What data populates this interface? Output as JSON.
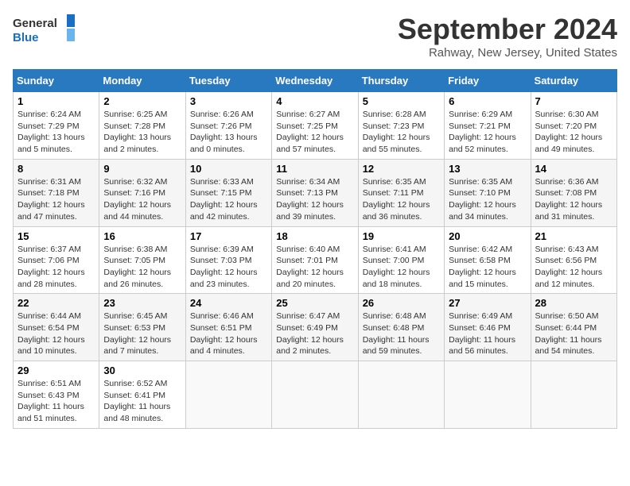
{
  "logo": {
    "line1": "General",
    "line2": "Blue"
  },
  "title": "September 2024",
  "location": "Rahway, New Jersey, United States",
  "days_header": [
    "Sunday",
    "Monday",
    "Tuesday",
    "Wednesday",
    "Thursday",
    "Friday",
    "Saturday"
  ],
  "weeks": [
    [
      {
        "day": "1",
        "info": "Sunrise: 6:24 AM\nSunset: 7:29 PM\nDaylight: 13 hours\nand 5 minutes."
      },
      {
        "day": "2",
        "info": "Sunrise: 6:25 AM\nSunset: 7:28 PM\nDaylight: 13 hours\nand 2 minutes."
      },
      {
        "day": "3",
        "info": "Sunrise: 6:26 AM\nSunset: 7:26 PM\nDaylight: 13 hours\nand 0 minutes."
      },
      {
        "day": "4",
        "info": "Sunrise: 6:27 AM\nSunset: 7:25 PM\nDaylight: 12 hours\nand 57 minutes."
      },
      {
        "day": "5",
        "info": "Sunrise: 6:28 AM\nSunset: 7:23 PM\nDaylight: 12 hours\nand 55 minutes."
      },
      {
        "day": "6",
        "info": "Sunrise: 6:29 AM\nSunset: 7:21 PM\nDaylight: 12 hours\nand 52 minutes."
      },
      {
        "day": "7",
        "info": "Sunrise: 6:30 AM\nSunset: 7:20 PM\nDaylight: 12 hours\nand 49 minutes."
      }
    ],
    [
      {
        "day": "8",
        "info": "Sunrise: 6:31 AM\nSunset: 7:18 PM\nDaylight: 12 hours\nand 47 minutes."
      },
      {
        "day": "9",
        "info": "Sunrise: 6:32 AM\nSunset: 7:16 PM\nDaylight: 12 hours\nand 44 minutes."
      },
      {
        "day": "10",
        "info": "Sunrise: 6:33 AM\nSunset: 7:15 PM\nDaylight: 12 hours\nand 42 minutes."
      },
      {
        "day": "11",
        "info": "Sunrise: 6:34 AM\nSunset: 7:13 PM\nDaylight: 12 hours\nand 39 minutes."
      },
      {
        "day": "12",
        "info": "Sunrise: 6:35 AM\nSunset: 7:11 PM\nDaylight: 12 hours\nand 36 minutes."
      },
      {
        "day": "13",
        "info": "Sunrise: 6:35 AM\nSunset: 7:10 PM\nDaylight: 12 hours\nand 34 minutes."
      },
      {
        "day": "14",
        "info": "Sunrise: 6:36 AM\nSunset: 7:08 PM\nDaylight: 12 hours\nand 31 minutes."
      }
    ],
    [
      {
        "day": "15",
        "info": "Sunrise: 6:37 AM\nSunset: 7:06 PM\nDaylight: 12 hours\nand 28 minutes."
      },
      {
        "day": "16",
        "info": "Sunrise: 6:38 AM\nSunset: 7:05 PM\nDaylight: 12 hours\nand 26 minutes."
      },
      {
        "day": "17",
        "info": "Sunrise: 6:39 AM\nSunset: 7:03 PM\nDaylight: 12 hours\nand 23 minutes."
      },
      {
        "day": "18",
        "info": "Sunrise: 6:40 AM\nSunset: 7:01 PM\nDaylight: 12 hours\nand 20 minutes."
      },
      {
        "day": "19",
        "info": "Sunrise: 6:41 AM\nSunset: 7:00 PM\nDaylight: 12 hours\nand 18 minutes."
      },
      {
        "day": "20",
        "info": "Sunrise: 6:42 AM\nSunset: 6:58 PM\nDaylight: 12 hours\nand 15 minutes."
      },
      {
        "day": "21",
        "info": "Sunrise: 6:43 AM\nSunset: 6:56 PM\nDaylight: 12 hours\nand 12 minutes."
      }
    ],
    [
      {
        "day": "22",
        "info": "Sunrise: 6:44 AM\nSunset: 6:54 PM\nDaylight: 12 hours\nand 10 minutes."
      },
      {
        "day": "23",
        "info": "Sunrise: 6:45 AM\nSunset: 6:53 PM\nDaylight: 12 hours\nand 7 minutes."
      },
      {
        "day": "24",
        "info": "Sunrise: 6:46 AM\nSunset: 6:51 PM\nDaylight: 12 hours\nand 4 minutes."
      },
      {
        "day": "25",
        "info": "Sunrise: 6:47 AM\nSunset: 6:49 PM\nDaylight: 12 hours\nand 2 minutes."
      },
      {
        "day": "26",
        "info": "Sunrise: 6:48 AM\nSunset: 6:48 PM\nDaylight: 11 hours\nand 59 minutes."
      },
      {
        "day": "27",
        "info": "Sunrise: 6:49 AM\nSunset: 6:46 PM\nDaylight: 11 hours\nand 56 minutes."
      },
      {
        "day": "28",
        "info": "Sunrise: 6:50 AM\nSunset: 6:44 PM\nDaylight: 11 hours\nand 54 minutes."
      }
    ],
    [
      {
        "day": "29",
        "info": "Sunrise: 6:51 AM\nSunset: 6:43 PM\nDaylight: 11 hours\nand 51 minutes."
      },
      {
        "day": "30",
        "info": "Sunrise: 6:52 AM\nSunset: 6:41 PM\nDaylight: 11 hours\nand 48 minutes."
      },
      {
        "day": "",
        "info": ""
      },
      {
        "day": "",
        "info": ""
      },
      {
        "day": "",
        "info": ""
      },
      {
        "day": "",
        "info": ""
      },
      {
        "day": "",
        "info": ""
      }
    ]
  ]
}
